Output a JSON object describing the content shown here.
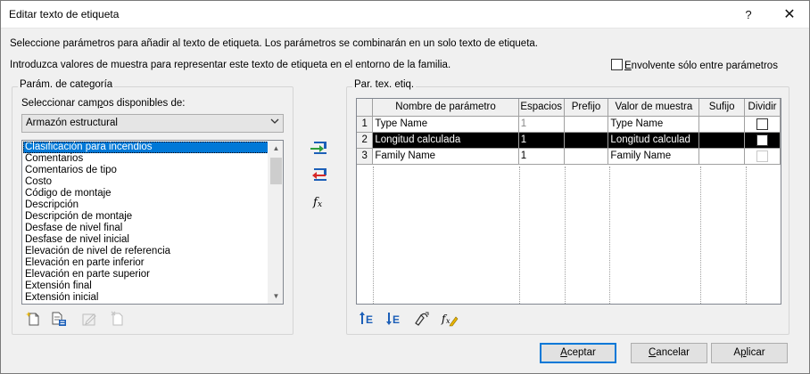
{
  "window": {
    "title": "Editar texto de etiqueta",
    "help_label": "?",
    "close_label": "✕"
  },
  "description": {
    "line1": "Seleccione parámetros para añadir al texto de etiqueta. Los parámetros se combinarán en un solo texto de etiqueta.",
    "line2": "Introduzca valores de muestra para representar este texto de etiqueta en el entorno de la familia."
  },
  "envelope_checkbox": {
    "label_pre": "",
    "label_ul": "E",
    "label_post": "nvolvente sólo entre parámetros",
    "checked": false
  },
  "category_group": {
    "title": "Parám. de categoría",
    "select_label_pre": "Seleccionar cam",
    "select_label_ul": "p",
    "select_label_post": "os disponibles de:",
    "combo_value": "Armazón estructural",
    "items": [
      "Clasificación para incendios",
      "Comentarios",
      "Comentarios de tipo",
      "Costo",
      "Código de montaje",
      "Descripción",
      "Descripción de montaje",
      "Desfase de nivel final",
      "Desfase de nivel inicial",
      "Elevación de nivel de referencia",
      "Elevación en parte inferior",
      "Elevación en parte superior",
      "Extensión final",
      "Extensión inicial"
    ],
    "selected_index": 0,
    "tools": [
      "new-parameter-icon",
      "edit-parameter-icon",
      "edit-shared-icon",
      "delete-parameter-icon"
    ]
  },
  "middle_tools": [
    "add-parameter-icon",
    "remove-parameter-icon",
    "fx-icon"
  ],
  "label_group": {
    "title": "Par. tex. etiq.",
    "columns": [
      "",
      "Nombre de parámetro",
      "Espacios",
      "Prefijo",
      "Valor de muestra",
      "Sufijo",
      "Dividir"
    ],
    "rows": [
      {
        "num": "1",
        "name": "Type Name",
        "spaces": "1",
        "prefix": "",
        "sample": "Type Name",
        "suffix": "",
        "break": false
      },
      {
        "num": "2",
        "name": "Longitud calculada",
        "spaces": "1",
        "prefix": "",
        "sample": "Longitud calculad",
        "suffix": "",
        "break": false
      },
      {
        "num": "3",
        "name": "Family Name",
        "spaces": "1",
        "prefix": "",
        "sample": "Family Name",
        "suffix": "",
        "break": false
      }
    ],
    "selected_row": 1,
    "tools": [
      "move-up-icon",
      "move-down-icon",
      "wrap-icon",
      "fx-edit-icon"
    ]
  },
  "buttons": {
    "ok_pre": "",
    "ok_ul": "A",
    "ok_post": "ceptar",
    "cancel_pre": "",
    "cancel_ul": "C",
    "cancel_post": "ancelar",
    "apply_pre": "A",
    "apply_ul": "p",
    "apply_post": "licar"
  },
  "colors": {
    "selection": "#0078d7",
    "row_selected": "#000000",
    "add_arrow": "#2e9e3a",
    "remove_arrow": "#d62828",
    "tool_blue": "#1c5fb8"
  }
}
